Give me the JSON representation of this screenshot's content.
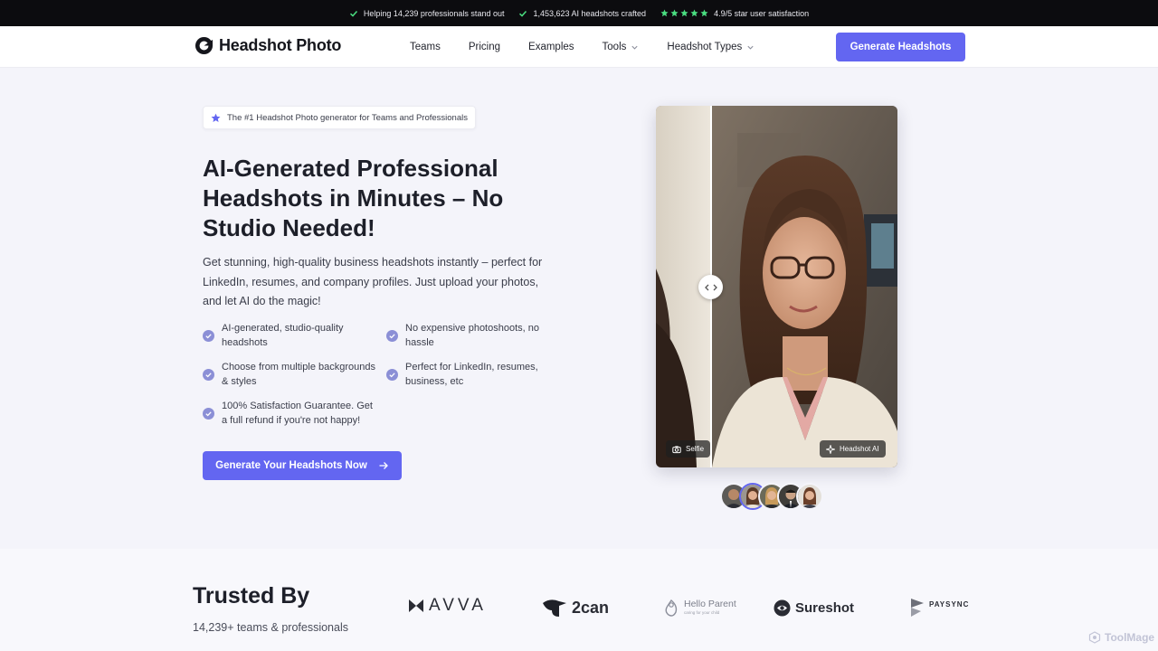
{
  "topbar": {
    "items": [
      "Helping 14,239 professionals stand out",
      "1,453,623 AI headshots crafted",
      "4.9/5 star user satisfaction"
    ]
  },
  "header": {
    "logo": "Headshot Photo",
    "nav": [
      {
        "label": "Teams",
        "dropdown": false
      },
      {
        "label": "Pricing",
        "dropdown": false
      },
      {
        "label": "Examples",
        "dropdown": false
      },
      {
        "label": "Tools",
        "dropdown": true
      },
      {
        "label": "Headshot Types",
        "dropdown": true
      }
    ],
    "cta": "Generate Headshots"
  },
  "hero": {
    "badge": "The #1 Headshot Photo generator for Teams and Professionals",
    "title": "AI-Generated Professional Headshots in Minutes – No Studio Needed!",
    "description": "Get stunning, high-quality business headshots instantly – perfect for LinkedIn, resumes, and company profiles. Just upload your photos, and let AI do the magic!",
    "features": [
      "AI-generated, studio-quality headshots",
      "No expensive photoshoots, no hassle",
      "Choose from multiple backgrounds & styles",
      "Perfect for LinkedIn, resumes, business, etc",
      "100% Satisfaction Guarantee. Get a full refund if you're not happy!"
    ],
    "cta": "Generate Your Headshots Now"
  },
  "compare": {
    "left_label": "Selfie",
    "right_label": "Headshot AI"
  },
  "trusted": {
    "title": "Trusted By",
    "subtitle": "14,239+ teams & professionals",
    "logos": [
      "AVVA",
      "2can",
      "Hello Parent",
      "Sureshot",
      "PAYSYNC"
    ],
    "hello_parent_tagline": "caring for your child"
  },
  "watermark": "ToolMage",
  "colors": {
    "accent": "#6366f1",
    "star": "#4ade80",
    "check": "#8b8fd6"
  }
}
